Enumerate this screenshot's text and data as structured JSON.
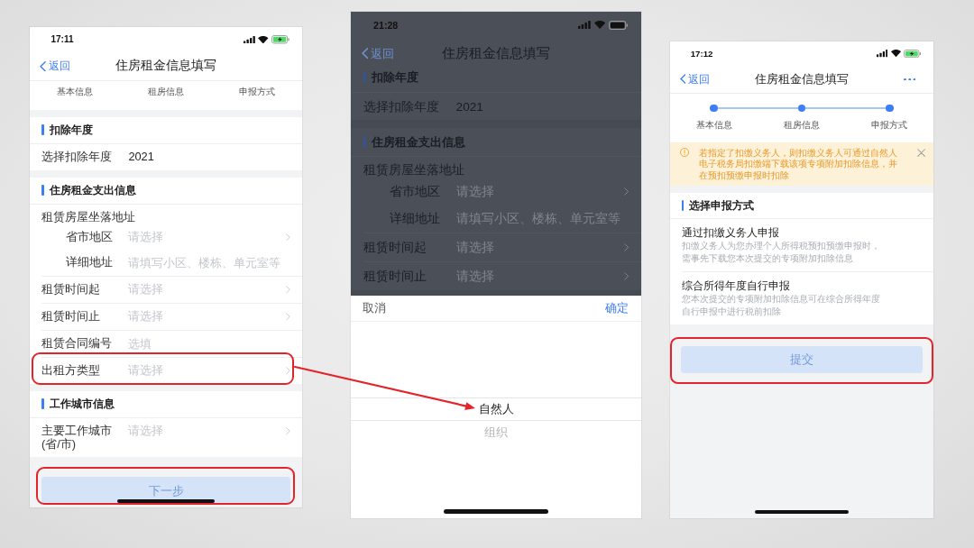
{
  "screens": [
    {
      "kind": "form",
      "status_bar": {
        "time": "17:11",
        "charging": true
      },
      "nav": {
        "back": "返回",
        "title": "住房租金信息填写"
      },
      "steps": {
        "kind": "labels",
        "items": [
          {
            "label": "基本信息"
          },
          {
            "label": "租房信息"
          },
          {
            "label": "申报方式"
          }
        ]
      },
      "sections": [
        {
          "title": "扣除年度",
          "rows": [
            {
              "kind": "value",
              "label": "选择扣除年度",
              "value": "2021",
              "highlighted": false
            }
          ]
        },
        {
          "title": "住房租金支出信息",
          "rows": [
            {
              "kind": "group",
              "label": "租赁房屋坐落地址",
              "highlighted": false,
              "children": [
                {
                  "kind": "select",
                  "label": "省市地区",
                  "placeholder": "请选择"
                },
                {
                  "kind": "input",
                  "label": "详细地址",
                  "placeholder": "请填写小区、楼栋、单元室等"
                }
              ]
            },
            {
              "kind": "select",
              "label": "租赁时间起",
              "placeholder": "请选择",
              "highlighted": false
            },
            {
              "kind": "select",
              "label": "租赁时间止",
              "placeholder": "请选择",
              "highlighted": false
            },
            {
              "kind": "input",
              "label": "租赁合同编号",
              "placeholder": "选填",
              "highlighted": false
            },
            {
              "kind": "select",
              "label": "出租方类型",
              "placeholder": "请选择",
              "highlighted": true
            }
          ]
        },
        {
          "title": "工作城市信息",
          "rows": [
            {
              "kind": "select",
              "label": "主要工作城市(省/市)",
              "placeholder": "请选择",
              "highlighted": false
            }
          ]
        }
      ],
      "button": {
        "label": "下一步",
        "disabled": true,
        "highlighted": true
      }
    },
    {
      "kind": "picker",
      "dimmed": true,
      "status_bar": {
        "time": "21:28",
        "charging": false
      },
      "nav": {
        "back": "返回",
        "title": "住房租金信息填写"
      },
      "sections": [
        {
          "title": "扣除年度",
          "rows": [
            {
              "kind": "value",
              "label": "选择扣除年度",
              "value": "2021"
            }
          ]
        },
        {
          "title": "住房租金支出信息",
          "rows": [
            {
              "kind": "group",
              "label": "租赁房屋坐落地址",
              "children": [
                {
                  "kind": "select",
                  "label": "省市地区",
                  "placeholder": "请选择"
                },
                {
                  "kind": "input",
                  "label": "详细地址",
                  "placeholder": "请填写小区、楼栋、单元室等"
                }
              ]
            },
            {
              "kind": "select",
              "label": "租赁时间起",
              "placeholder": "请选择"
            },
            {
              "kind": "select",
              "label": "租赁时间止",
              "placeholder": "请选择"
            }
          ]
        }
      ],
      "picker": {
        "cancel": "取消",
        "confirm": "确定",
        "options": [
          {
            "label": "自然人",
            "selected": true
          },
          {
            "label": "组织",
            "selected": false
          }
        ]
      }
    },
    {
      "kind": "method",
      "status_bar": {
        "time": "17:12",
        "charging": true
      },
      "nav": {
        "back": "返回",
        "title": "住房租金信息填写",
        "more": true
      },
      "steps": {
        "kind": "dots",
        "items": [
          {
            "label": "基本信息",
            "reached": true
          },
          {
            "label": "租房信息",
            "reached": true
          },
          {
            "label": "申报方式",
            "reached": true
          }
        ]
      },
      "notice": {
        "text": "若指定了扣缴义务人，则扣缴义务人可通过自然人电子税务局扣缴端下载该项专项附加扣除信息，并在预扣预缴申报时扣除",
        "dismissible": true
      },
      "choice": {
        "title": "选择申报方式",
        "options": [
          {
            "title": "通过扣缴义务人申报",
            "description": "扣缴义务人为您办理个人所得税预扣预缴申报时，需事先下载您本次提交的专项附加扣除信息"
          },
          {
            "title": "综合所得年度自行申报",
            "description": "您本次提交的专项附加扣除信息可在综合所得年度自行申报中进行税前扣除"
          }
        ]
      },
      "button": {
        "label": "提交",
        "disabled": true,
        "highlighted": true
      }
    }
  ]
}
